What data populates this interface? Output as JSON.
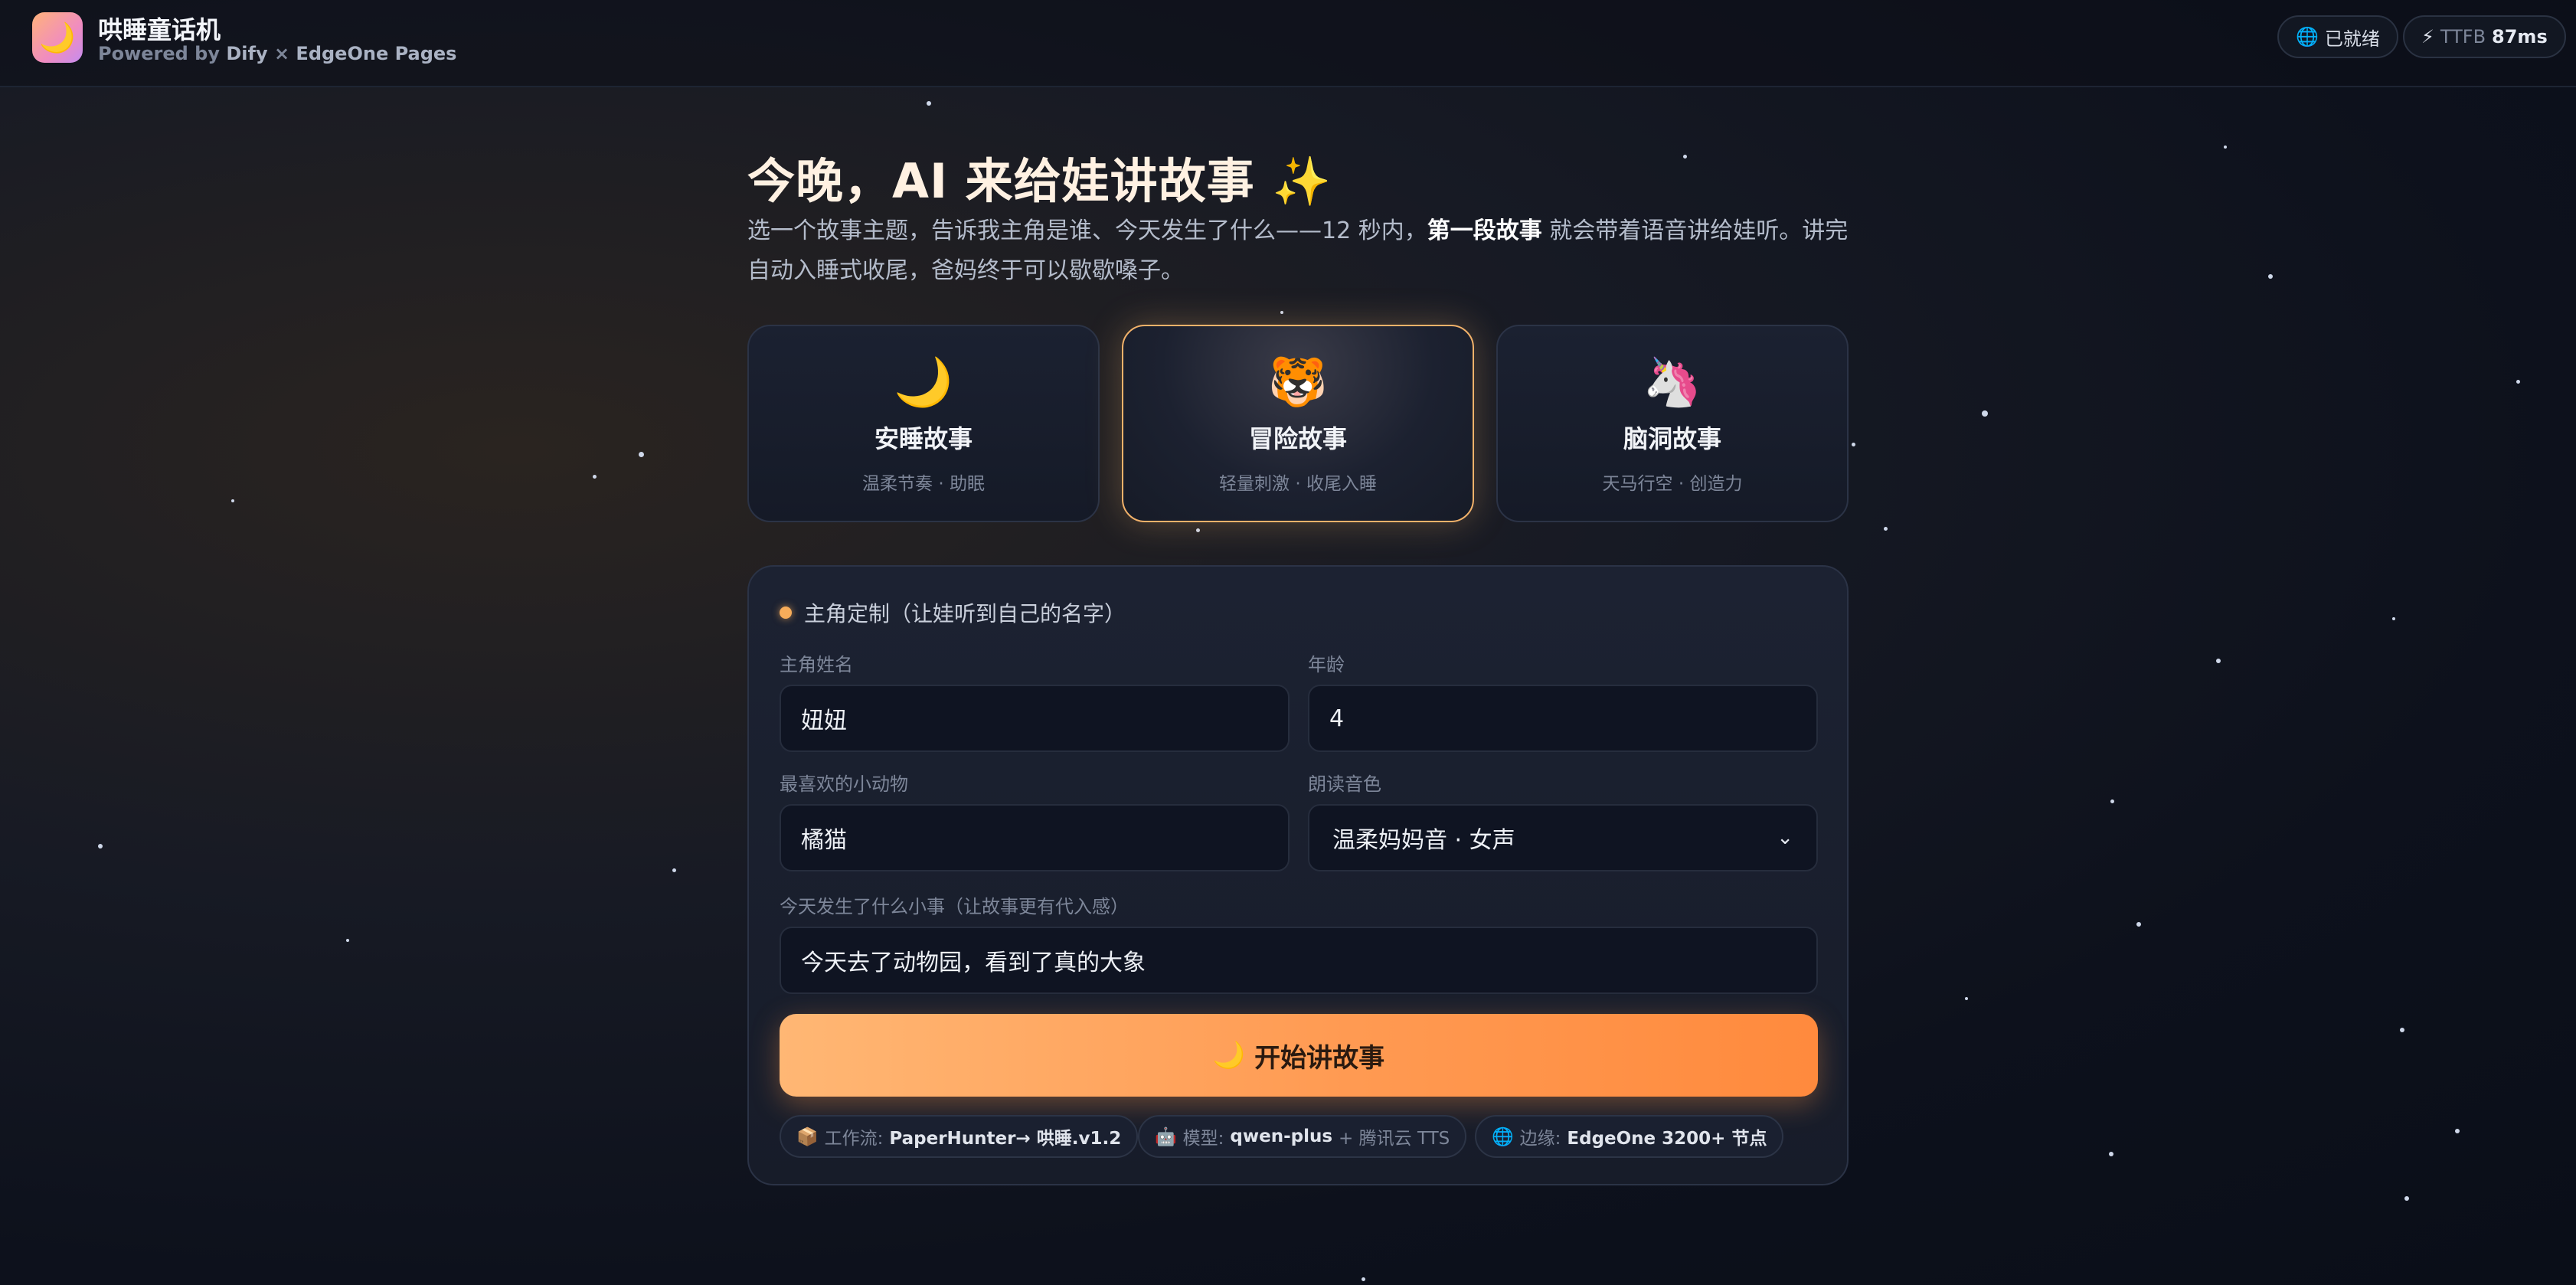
{
  "header": {
    "logo_emoji": "🌙",
    "app_title": "哄睡童话机",
    "powered_prefix": "Powered by",
    "powered_dify": "Dify",
    "powered_sep": "×",
    "powered_edge": "EdgeOne Pages",
    "status_icon": "🌐",
    "status_label": "已就绪",
    "ttfb_icon": "⚡",
    "ttfb_label": "TTFB",
    "ttfb_value": "87ms"
  },
  "hero": {
    "title": "今晚，AI 来给娃讲故事 ✨",
    "desc_before": "选一个故事主题，告诉我主角是谁、今天发生了什么——12 秒内，",
    "desc_bold": "第一段故事",
    "desc_after": " 就会带着语音讲给娃听。讲完自动入睡式收尾，爸妈终于可以歇歇嗓子。"
  },
  "themes": [
    {
      "icon": "🌙",
      "title": "安睡故事",
      "subtitle": "温柔节奏 · 助眠",
      "selected": false
    },
    {
      "icon": "🐯",
      "title": "冒险故事",
      "subtitle": "轻量刺激 · 收尾入睡",
      "selected": true
    },
    {
      "icon": "🦄",
      "title": "脑洞故事",
      "subtitle": "天马行空 · 创造力",
      "selected": false
    }
  ],
  "form": {
    "heading": "主角定制（让娃听到自己的名字）",
    "name_label": "主角姓名",
    "name_value": "妞妞",
    "age_label": "年龄",
    "age_value": "4",
    "animal_label": "最喜欢的小动物",
    "animal_value": "橘猫",
    "voice_label": "朗读音色",
    "voice_value": "温柔妈妈音 · 女声",
    "event_label": "今天发生了什么小事（让故事更有代入感）",
    "event_value": "今天去了动物园，看到了真的大象",
    "start_icon": "🌙",
    "start_label": "开始讲故事"
  },
  "chips": [
    {
      "icon": "📦",
      "label": "工作流:",
      "value": "PaperHunter→ 哄睡.v1.2",
      "extra": ""
    },
    {
      "icon": "🤖",
      "label": "模型:",
      "value": "qwen-plus",
      "extra": "+ 腾讯云 TTS"
    },
    {
      "icon": "🌐",
      "label": "边缘:",
      "value": "EdgeOne 3200+ 节点",
      "extra": ""
    }
  ],
  "colors": {
    "accent": "#ff9a52",
    "selected_border": "#f2b26a",
    "background": "#0d111c"
  }
}
